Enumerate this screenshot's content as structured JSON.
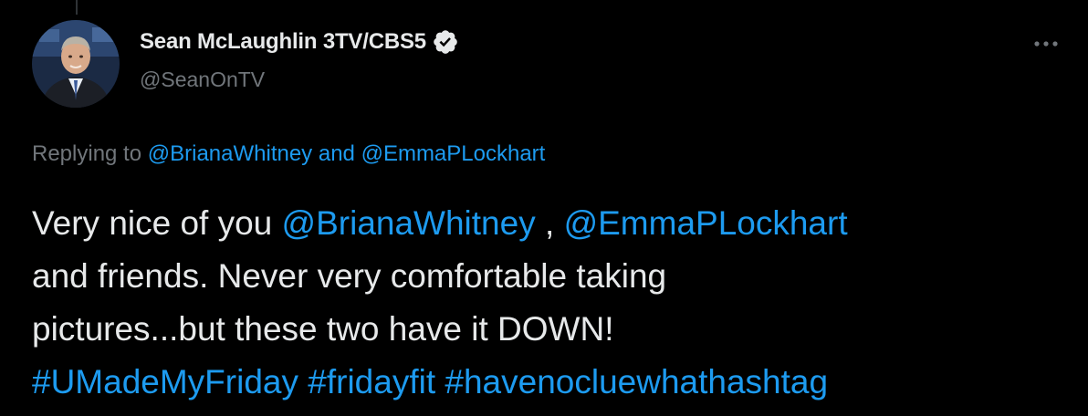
{
  "tweet": {
    "author": {
      "display_name": "Sean McLaughlin 3TV/CBS5",
      "handle": "@SeanOnTV",
      "verified": true,
      "avatar": "news-anchor-portrait"
    },
    "replying": {
      "prefix": "Replying to",
      "user1": "@BrianaWhitney",
      "joiner": "and",
      "user2": "@EmmaPLockhart"
    },
    "body": {
      "l1_text": "Very nice of you",
      "l1_mention1": "@BrianaWhitney",
      "l1_sep": ",",
      "l1_mention2": "@EmmaPLockhart",
      "l2_text": "and friends. Never very comfortable taking",
      "l3_text": "pictures...but these two have it DOWN!",
      "hashtags": [
        "#UMadeMyFriday",
        "#fridayfit",
        "#havenocluewhathashtag"
      ]
    },
    "icons": {
      "verified": "verified-badge-icon",
      "more": "more-options-icon"
    },
    "colors": {
      "background": "#000000",
      "text": "#e7e9ea",
      "muted": "#71767b",
      "link": "#1d9bf0"
    }
  }
}
